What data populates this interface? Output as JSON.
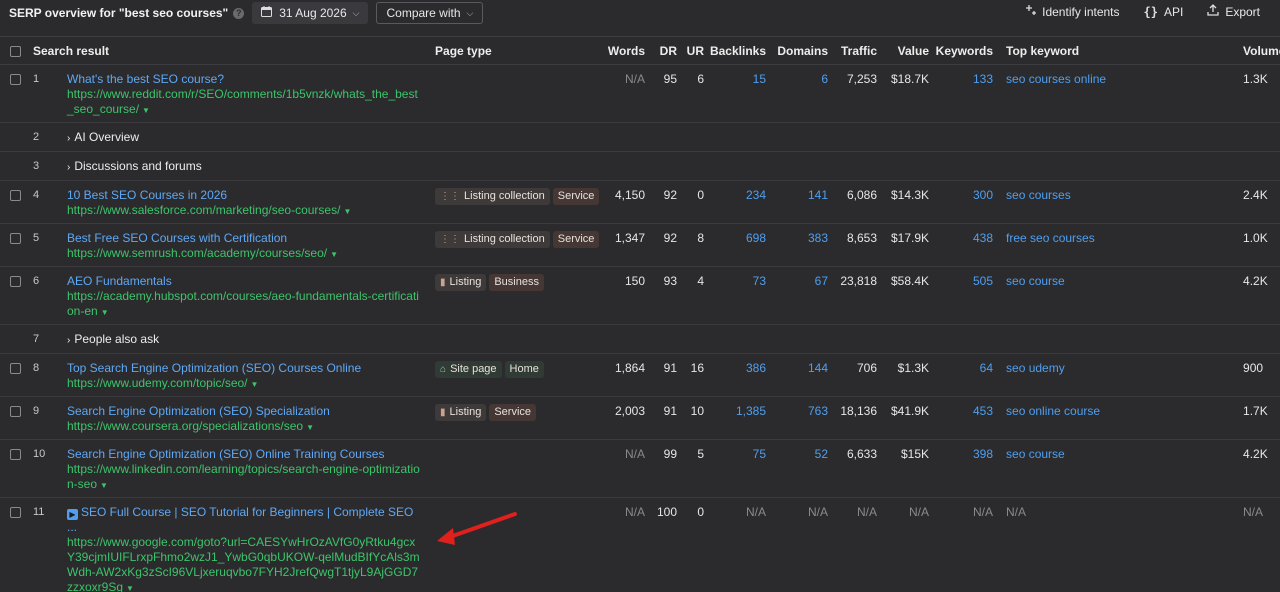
{
  "header": {
    "title": "SERP overview for \"best seo courses\"",
    "date": "31 Aug 2026",
    "compare": "Compare with",
    "identify": "Identify intents",
    "api": "API",
    "export": "Export"
  },
  "columns": {
    "result": "Search result",
    "page_type": "Page type",
    "words": "Words",
    "dr": "DR",
    "ur": "UR",
    "backlinks": "Backlinks",
    "domains": "Domains",
    "traffic": "Traffic",
    "value": "Value",
    "keywords": "Keywords",
    "top_keyword": "Top keyword",
    "volume": "Volume"
  },
  "rows": [
    {
      "n": "1",
      "title": "What's the best SEO course?",
      "url": "https://www.reddit.com/r/SEO/comments/1b5vnzk/whats_the_best_seo_course/",
      "words": "N/A",
      "dr": "95",
      "ur": "6",
      "backlinks": "15",
      "domains": "6",
      "traffic": "7,253",
      "value": "$18.7K",
      "keywords": "133",
      "top_keyword": "seo courses online",
      "volume": "1.3K"
    },
    {
      "n": "2",
      "group": "AI Overview"
    },
    {
      "n": "3",
      "group": "Discussions and forums"
    },
    {
      "n": "4",
      "title": "10 Best SEO Courses in 2026",
      "url": "https://www.salesforce.com/marketing/seo-courses/",
      "tag1": "Listing collection",
      "tag2": "Service",
      "words": "4,150",
      "dr": "92",
      "ur": "0",
      "backlinks": "234",
      "domains": "141",
      "traffic": "6,086",
      "value": "$14.3K",
      "keywords": "300",
      "top_keyword": "seo courses",
      "volume": "2.4K"
    },
    {
      "n": "5",
      "title": "Best Free SEO Courses with Certification",
      "url": "https://www.semrush.com/academy/courses/seo/",
      "tag1": "Listing collection",
      "tag2": "Service",
      "words": "1,347",
      "dr": "92",
      "ur": "8",
      "backlinks": "698",
      "domains": "383",
      "traffic": "8,653",
      "value": "$17.9K",
      "keywords": "438",
      "top_keyword": "free seo courses",
      "volume": "1.0K"
    },
    {
      "n": "6",
      "title": "AEO Fundamentals",
      "url": "https://academy.hubspot.com/courses/aeo-fundamentals-certification-en",
      "tag1": "Listing",
      "tag2": "Business",
      "words": "150",
      "dr": "93",
      "ur": "4",
      "backlinks": "73",
      "domains": "67",
      "traffic": "23,818",
      "value": "$58.4K",
      "keywords": "505",
      "top_keyword": "seo course",
      "volume": "4.2K"
    },
    {
      "n": "7",
      "group": "People also ask"
    },
    {
      "n": "8",
      "title": "Top Search Engine Optimization (SEO) Courses Online",
      "url": "https://www.udemy.com/topic/seo/",
      "tag1": "Site page",
      "tag2": "Home",
      "words": "1,864",
      "dr": "91",
      "ur": "16",
      "backlinks": "386",
      "domains": "144",
      "traffic": "706",
      "value": "$1.3K",
      "keywords": "64",
      "top_keyword": "seo udemy",
      "volume": "900"
    },
    {
      "n": "9",
      "title": "Search Engine Optimization (SEO) Specialization",
      "url": "https://www.coursera.org/specializations/seo",
      "tag1": "Listing",
      "tag2": "Service",
      "words": "2,003",
      "dr": "91",
      "ur": "10",
      "backlinks": "1,385",
      "domains": "763",
      "traffic": "18,136",
      "value": "$41.9K",
      "keywords": "453",
      "top_keyword": "seo online course",
      "volume": "1.7K"
    },
    {
      "n": "10",
      "title": "Search Engine Optimization (SEO) Online Training Courses",
      "url": "https://www.linkedin.com/learning/topics/search-engine-optimization-seo",
      "words": "N/A",
      "dr": "99",
      "ur": "5",
      "backlinks": "75",
      "domains": "52",
      "traffic": "6,633",
      "value": "$15K",
      "keywords": "398",
      "top_keyword": "seo course",
      "volume": "4.2K"
    },
    {
      "n": "11",
      "title": "SEO Full Course | SEO Tutorial for Beginners | Complete SEO ...",
      "url": "https://www.google.com/goto?url=CAESYwHrOzAVfG0yRtku4gcxY39cjmIUIFLrxpFhmo2wzJ1_YwbG0qbUKOW-qelMudBIfYcAls3mWdh-AW2xKg3zScI96VLjxeruqvbo7FYH2JrefQwgT1tjyL9AjGGD7zzxoxr9Sg",
      "words": "N/A",
      "dr": "100",
      "ur": "0",
      "backlinks": "N/A",
      "domains": "N/A",
      "traffic": "N/A",
      "value": "N/A",
      "keywords": "N/A",
      "top_keyword": "N/A",
      "volume": "N/A"
    }
  ]
}
